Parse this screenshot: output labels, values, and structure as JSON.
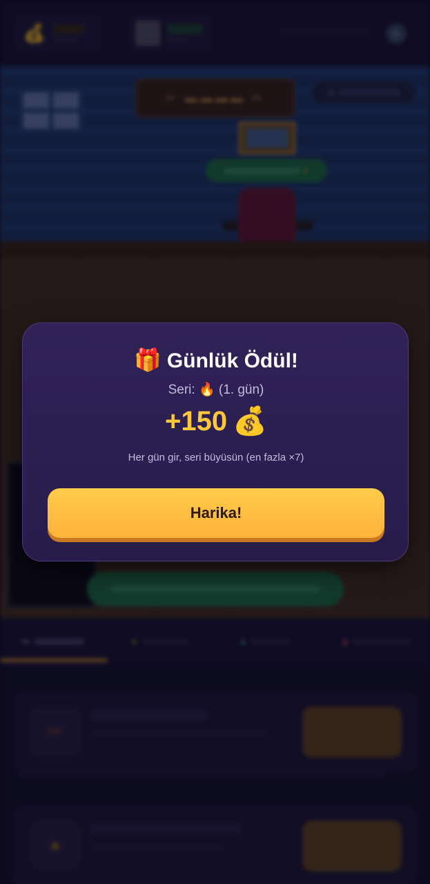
{
  "modal": {
    "gift_emoji": "🎁",
    "title": "Günlük Ödül!",
    "streak_text": "Seri: 🔥 (1. gün)",
    "reward_amount": "+150",
    "reward_emoji": "💰",
    "hint": "Her gün gir, seri büyüsün (en fazla ×7)",
    "button_label": "Harika!"
  },
  "colors": {
    "accent": "#ffc83a",
    "button": "#ffb23a",
    "modal_bg": "#2b1f52"
  }
}
